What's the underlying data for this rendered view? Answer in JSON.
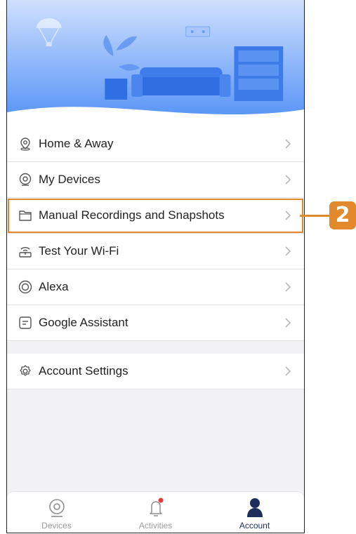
{
  "menu": {
    "items": [
      {
        "label": "Home & Away",
        "icon": "location-pin-icon"
      },
      {
        "label": "My Devices",
        "icon": "camera-icon"
      },
      {
        "label": "Manual Recordings and Snapshots",
        "icon": "folder-icon",
        "highlighted": true
      },
      {
        "label": "Test Your Wi-Fi",
        "icon": "wifi-router-icon"
      },
      {
        "label": "Alexa",
        "icon": "alexa-icon"
      },
      {
        "label": "Google Assistant",
        "icon": "google-assistant-icon"
      }
    ],
    "settings": {
      "label": "Account Settings",
      "icon": "gear-icon"
    }
  },
  "tabbar": {
    "tabs": [
      {
        "label": "Devices",
        "icon": "camera-icon",
        "active": false
      },
      {
        "label": "Activities",
        "icon": "bell-icon",
        "active": false,
        "badge": true
      },
      {
        "label": "Account",
        "icon": "person-icon",
        "active": true
      }
    ]
  },
  "callout": {
    "number": "2"
  },
  "colors": {
    "accent": "#e28a2b",
    "hero_blue": "#5a97f5",
    "tab_active": "#1d2e5a",
    "badge_red": "#e83a3a"
  }
}
